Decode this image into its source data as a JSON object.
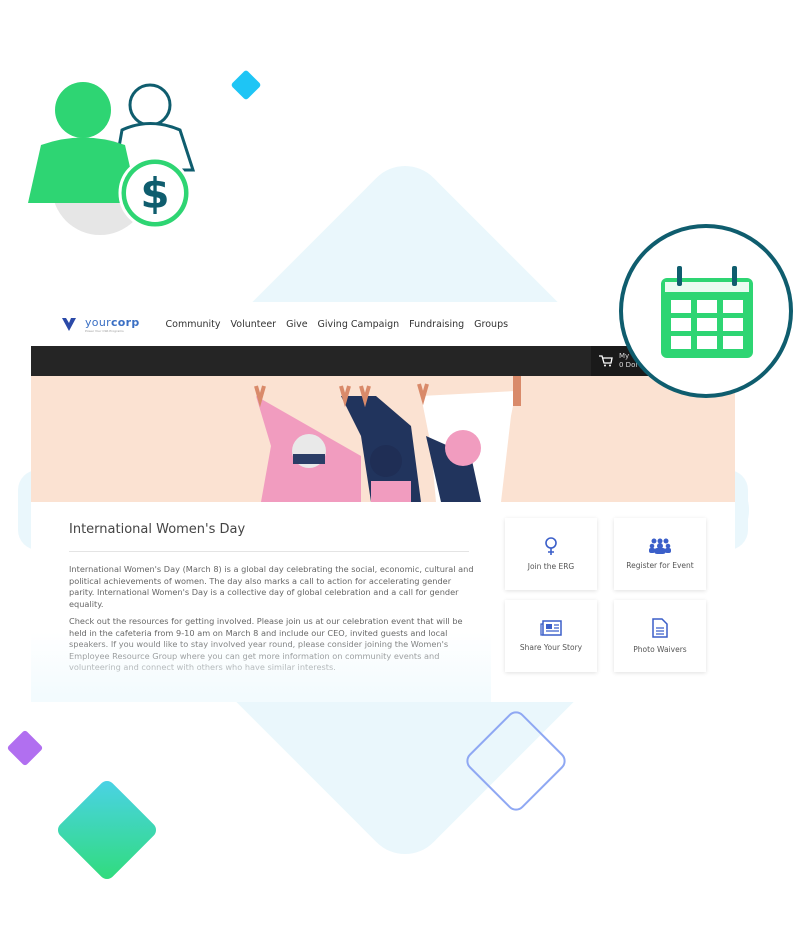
{
  "brand": {
    "name_light": "your",
    "name_bold": "corp",
    "tagline": "Power Your CSR Programs"
  },
  "nav": {
    "items": [
      "Community",
      "Volunteer",
      "Give",
      "Giving Campaign",
      "Fundraising",
      "Groups"
    ]
  },
  "cart": {
    "label": "My",
    "value": "0 Dol"
  },
  "page": {
    "title": "International Women's Day",
    "paragraphs": [
      "International Women's Day (March 8) is a global day celebrating the social, economic, cultural and political achievements of women. The day also marks a call to action for accelerating gender parity. International Women's Day is a collective day of global celebration and a call for gender equality.",
      "Check out the resources for getting involved. Please join us at our celebration event that will be held in the cafeteria from 9-10 am on March 8 and include our CEO, invited guests and local speakers. If you would like to stay involved year round, please consider joining the Women's Employee Resource Group where you can get more information on community events and volunteering and connect with others who have similar interests."
    ]
  },
  "actions": [
    {
      "label": "Join the ERG",
      "icon": "female-symbol-icon"
    },
    {
      "label": "Register for Event",
      "icon": "group-icon"
    },
    {
      "label": "Share Your Story",
      "icon": "newspaper-icon"
    },
    {
      "label": "Photo Waivers",
      "icon": "document-icon"
    }
  ],
  "colors": {
    "accent": "#3b5fc9",
    "green": "#2ed573",
    "teal": "#0f5d6e",
    "dark": "#252525",
    "banner": "#fbe2d2"
  }
}
